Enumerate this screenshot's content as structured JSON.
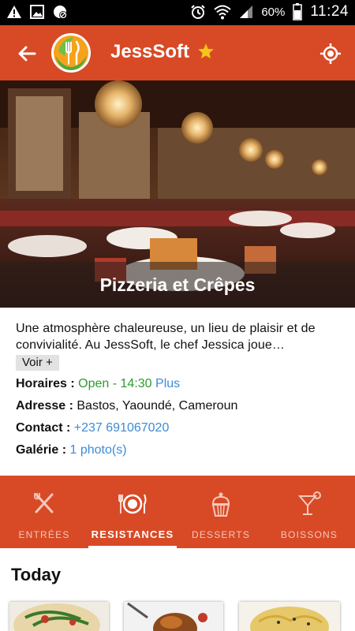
{
  "status_bar": {
    "battery_text": "60%",
    "time": "11:24",
    "icons": [
      "warning-icon",
      "image-icon",
      "blocked-icon",
      "alarm-icon",
      "wifi-icon",
      "signal-icon",
      "battery-icon"
    ]
  },
  "app_bar": {
    "title": "JessSoft",
    "icons": [
      "back-arrow-icon",
      "restaurant-logo",
      "star-icon",
      "location-icon"
    ],
    "colors": {
      "bar": "#d84a26",
      "star": "#f5c518"
    }
  },
  "hero": {
    "caption": "Pizzeria et Crêpes"
  },
  "info": {
    "description": "Une atmosphère chaleureuse, un lieu de plaisir et de convivialité. Au JessSoft, le chef Jessica joue…",
    "more_button": "Voir +",
    "hours": {
      "label": "Horaires :",
      "value": "Open - 14:30",
      "more": "Plus"
    },
    "address": {
      "label": "Adresse :",
      "value": "Bastos, Yaoundé, Cameroun"
    },
    "contact": {
      "label": "Contact :",
      "value": "+237 691067020"
    },
    "gallery": {
      "label": "Galérie :",
      "value": "1 photo(s)"
    },
    "colors": {
      "open": "#2e9a2e",
      "link": "#3d8bd6"
    }
  },
  "tabs": [
    {
      "label": "ENTRÉES",
      "icon": "fork-knife-icon",
      "active": false
    },
    {
      "label": "RESISTANCES",
      "icon": "plate-icon",
      "active": true
    },
    {
      "label": "DESSERTS",
      "icon": "cupcake-icon",
      "active": false
    },
    {
      "label": "BOISSONS",
      "icon": "cocktail-icon",
      "active": false
    }
  ],
  "today": {
    "heading": "Today"
  }
}
